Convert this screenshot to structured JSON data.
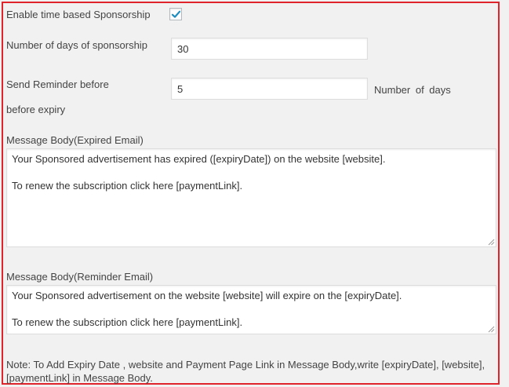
{
  "settings": {
    "enable_label": "Enable time based Sponsorship",
    "enable_checked": true,
    "days_label": "Number of days of sponsorship",
    "days_value": "30",
    "reminder_label_line1": "Send Reminder before",
    "reminder_label_line2": "before expiry",
    "reminder_value": "5",
    "reminder_suffix": "Number of days",
    "expired_label": "Message Body(Expired Email)",
    "expired_body_line1": "Your Sponsored advertisement has expired ([expiryDate]) on the website [website].",
    "expired_body_line2": "To renew the subscription click here [paymentLink].",
    "reminder_body_label": "Message Body(Reminder Email)",
    "reminder_body_line1": "Your Sponsored advertisement on the website [website] will expire on the [expiryDate].",
    "reminder_body_line2": "To renew the subscription click here [paymentLink].",
    "note": "Note: To Add Expiry Date , website and Payment Page Link in Message Body,write [expiryDate], [website],[paymentLink] in Message Body."
  },
  "colors": {
    "frame_border": "#e0242c",
    "check_mark": "#1e8cbe"
  },
  "icons": {
    "checkbox": "check-icon",
    "resize": "resize-grip-icon"
  }
}
